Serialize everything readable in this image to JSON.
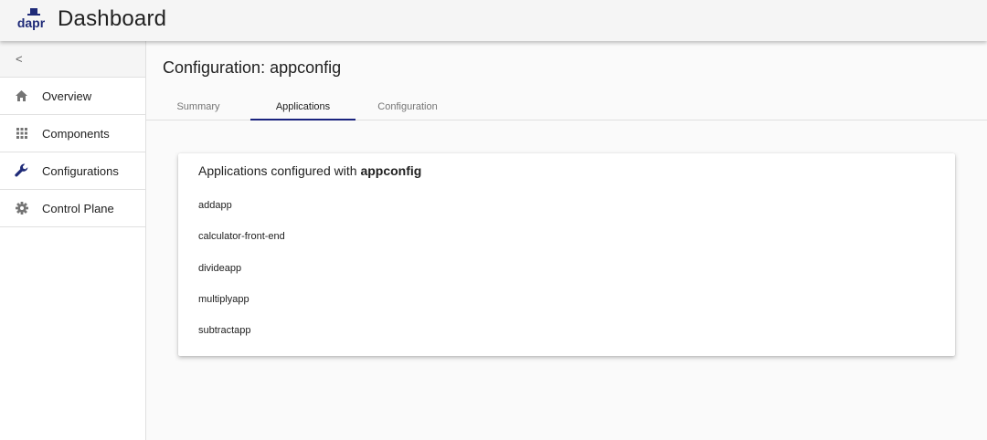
{
  "header": {
    "logo_text": "dapr",
    "title": "Dashboard",
    "brand_color": "#1e2a78"
  },
  "sidebar": {
    "collapse_icon": "chevron-left-icon",
    "collapse_glyph": "<",
    "items": [
      {
        "label": "Overview",
        "icon": "home-icon"
      },
      {
        "label": "Components",
        "icon": "grid-icon"
      },
      {
        "label": "Configurations",
        "icon": "wrench-icon"
      },
      {
        "label": "Control Plane",
        "icon": "gear-icon"
      }
    ]
  },
  "main": {
    "title": "Configuration: appconfig",
    "tabs": [
      {
        "label": "Summary",
        "active": false
      },
      {
        "label": "Applications",
        "active": true
      },
      {
        "label": "Configuration",
        "active": false
      }
    ],
    "card": {
      "title_prefix": "Applications configured with ",
      "title_name": "appconfig",
      "apps": [
        "addapp",
        "calculator-front-end",
        "divideapp",
        "multiplyapp",
        "subtractapp"
      ]
    }
  }
}
